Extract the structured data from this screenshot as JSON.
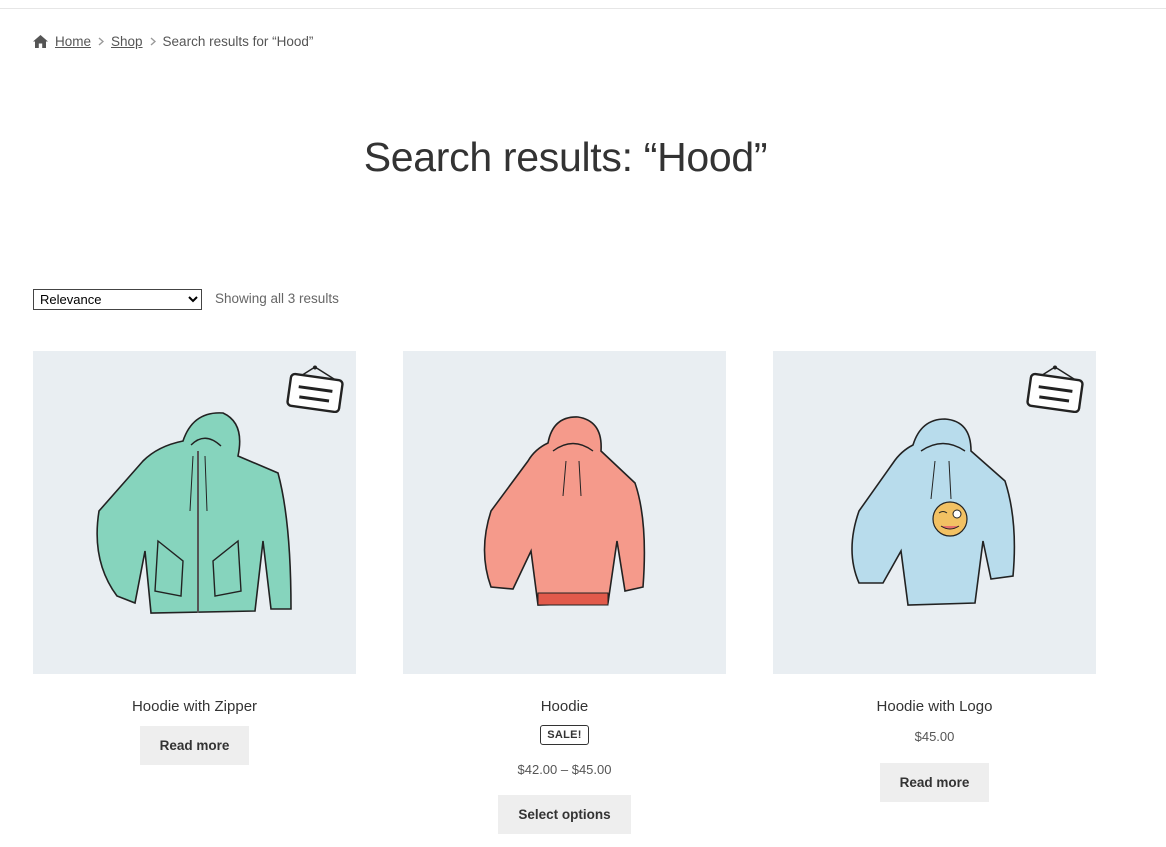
{
  "breadcrumb": {
    "home": "Home",
    "shop": "Shop",
    "current": "Search results for “Hood”"
  },
  "page_title": "Search results: “Hood”",
  "ordering": {
    "selected": "Relevance"
  },
  "result_count": "Showing all 3 results",
  "products": [
    {
      "title": "Hoodie with Zipper",
      "button": "Read more",
      "badge": "coming-soon-icon",
      "color": "#86d4bd"
    },
    {
      "title": "Hoodie",
      "sale_badge": "SALE!",
      "price": "$42.00 – $45.00",
      "button": "Select options",
      "color": "#f59a8b"
    },
    {
      "title": "Hoodie with Logo",
      "price": "$45.00",
      "button": "Read more",
      "badge": "coming-soon-icon",
      "color": "#b8dcec"
    }
  ],
  "colors": {
    "thumb_bg": "#e9eef2",
    "button_bg": "#eeeeee",
    "text": "#333333"
  }
}
